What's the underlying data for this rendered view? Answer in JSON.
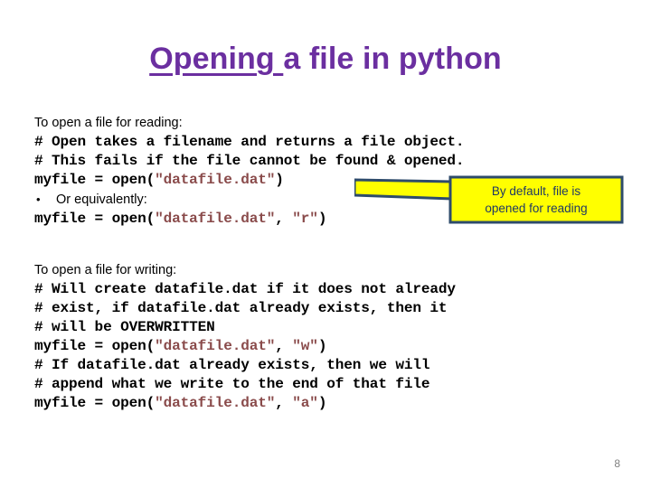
{
  "slide": {
    "title_underlined": "Opening ",
    "title_rest": "a file in python",
    "title_color": "#6b2fa0",
    "page_number": "8",
    "background": "#ffffff"
  },
  "reading_block": {
    "heading": "To open a file for reading:",
    "bullet_glyph": "•",
    "bullet_text": "Or equivalently:",
    "lines": [
      {
        "kind": "code",
        "segments": [
          {
            "text": "# Open takes a filename and returns a file object.",
            "style": "plain"
          }
        ]
      },
      {
        "kind": "code",
        "segments": [
          {
            "text": "# This fails if the file cannot be found & opened.",
            "style": "plain"
          }
        ]
      },
      {
        "kind": "code",
        "segments": [
          {
            "text": "myfile = open(",
            "style": "plain"
          },
          {
            "text": "\"datafile.dat\"",
            "style": "string"
          },
          {
            "text": ")",
            "style": "plain"
          }
        ]
      },
      {
        "kind": "code",
        "segments": [
          {
            "text": "myfile = open(",
            "style": "plain"
          },
          {
            "text": "\"datafile.dat\"",
            "style": "string"
          },
          {
            "text": ", ",
            "style": "plain"
          },
          {
            "text": "\"r\"",
            "style": "string"
          },
          {
            "text": ")",
            "style": "plain"
          }
        ]
      }
    ]
  },
  "writing_block": {
    "heading": "To open a file for writing:",
    "lines": [
      {
        "kind": "code",
        "segments": [
          {
            "text": "# Will create datafile.dat if it does not already",
            "style": "plain"
          }
        ]
      },
      {
        "kind": "code",
        "segments": [
          {
            "text": "# exist, if datafile.dat already exists, then it",
            "style": "plain"
          }
        ]
      },
      {
        "kind": "code",
        "segments": [
          {
            "text": "# will be OVERWRITTEN",
            "style": "plain"
          }
        ]
      },
      {
        "kind": "code",
        "segments": [
          {
            "text": "myfile = open(",
            "style": "plain"
          },
          {
            "text": "\"datafile.dat\"",
            "style": "string"
          },
          {
            "text": ", ",
            "style": "plain"
          },
          {
            "text": "\"w\"",
            "style": "string"
          },
          {
            "text": ")",
            "style": "plain"
          }
        ]
      },
      {
        "kind": "code",
        "segments": [
          {
            "text": "# If datafile.dat already exists, then we will",
            "style": "plain"
          }
        ]
      },
      {
        "kind": "code",
        "segments": [
          {
            "text": "# append what we write to the end of that file",
            "style": "plain"
          }
        ]
      },
      {
        "kind": "code",
        "segments": [
          {
            "text": "myfile = open(",
            "style": "plain"
          },
          {
            "text": "\"datafile.dat\"",
            "style": "string"
          },
          {
            "text": ", ",
            "style": "plain"
          },
          {
            "text": "\"a\"",
            "style": "string"
          },
          {
            "text": ")",
            "style": "plain"
          }
        ]
      }
    ]
  },
  "callout": {
    "line1": "By default, file is",
    "line2": "opened for reading",
    "fill_color": "#ffff00",
    "border_color": "#2e4b6b",
    "text_color": "#1f3864"
  }
}
